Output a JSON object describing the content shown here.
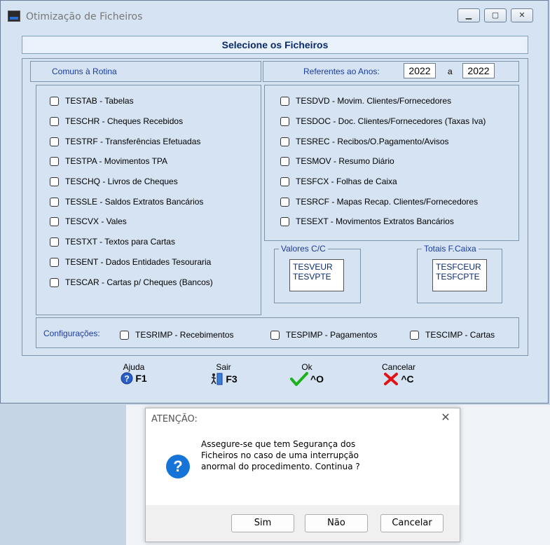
{
  "window": {
    "title": "Otimização de Ficheiros"
  },
  "banner": "Selecione os Ficheiros",
  "headers": {
    "left": "Comuns à Rotina",
    "right": "Referentes ao Anos:",
    "year_from": "2022",
    "year_sep": "a",
    "year_to": "2022"
  },
  "left_files": [
    "TESTAB - Tabelas",
    "TESCHR - Cheques Recebidos",
    "TESTRF - Transferências Efetuadas",
    "TESTPA - Movimentos TPA",
    "TESCHQ - Livros de Cheques",
    "TESSLE - Saldos Extratos Bancários",
    "TESCVX - Vales",
    "TESTXT - Textos para Cartas",
    "TESENT - Dados Entidades Tesouraria",
    "TESCAR - Cartas p/ Cheques (Bancos)"
  ],
  "right_files": [
    "TESDVD - Movim. Clientes/Fornecedores",
    "TESDOC - Doc. Clientes/Fornecedores (Taxas Iva)",
    "TESREC - Recibos/O.Pagamento/Avisos",
    "TESMOV - Resumo Diário",
    "TESFCX - Folhas de Caixa",
    "TESRCF - Mapas Recap. Clientes/Fornecedores",
    "TESEXT - Movimentos Extratos Bancários"
  ],
  "valores": {
    "label": "Valores C/C",
    "items": [
      "TESVEUR",
      "TESVPTE"
    ]
  },
  "totais": {
    "label": "Totais F.Caixa",
    "items": [
      "TESFCEUR",
      "TESFCPTE"
    ]
  },
  "config": {
    "label": "Configurações:",
    "items": [
      "TESRIMP - Recebimentos",
      "TESPIMP - Pagamentos",
      "TESCIMP - Cartas"
    ]
  },
  "fkeys": [
    {
      "caption": "Ajuda",
      "key": "F1",
      "icon": "help-icon",
      "color": "#2a5fc8"
    },
    {
      "caption": "Sair",
      "key": "F3",
      "icon": "exit-door-icon",
      "color": "#1a3c9c"
    },
    {
      "caption": "Ok",
      "key": "^O",
      "icon": "check-icon",
      "color": "#1bb31b"
    },
    {
      "caption": "Cancelar",
      "key": "^C",
      "icon": "cross-icon",
      "color": "#e01414"
    }
  ],
  "dialog": {
    "title": "ATENÇÃO:",
    "lines": [
      "Assegure-se que tem Segurança dos",
      "Ficheiros no caso de uma interrupção",
      "anormal do procedimento.  Continua ?"
    ],
    "buttons": [
      "Sim",
      "Não",
      "Cancelar"
    ]
  }
}
